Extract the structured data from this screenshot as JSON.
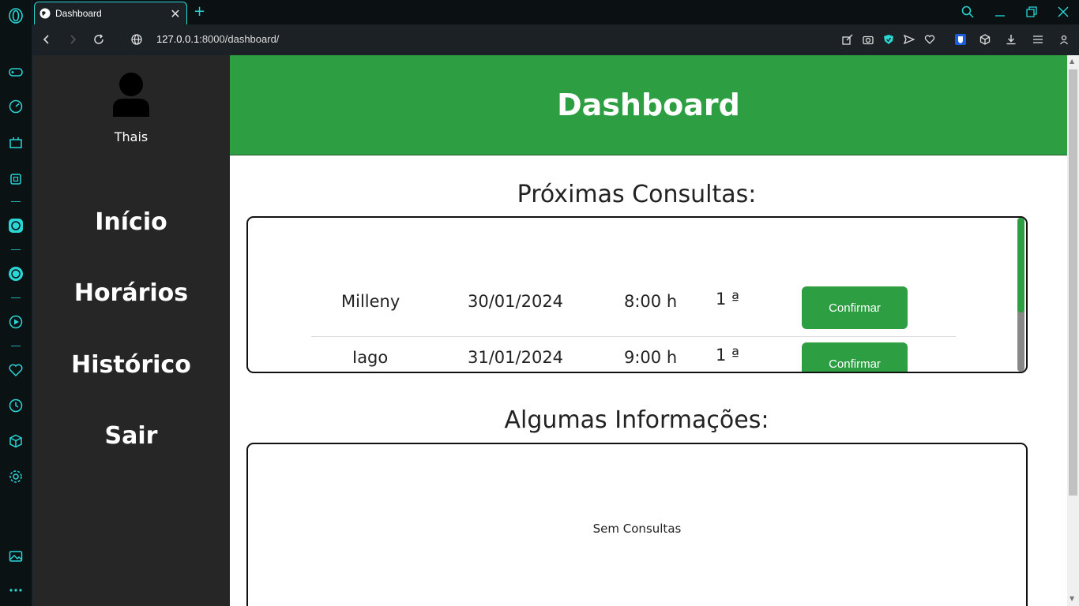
{
  "browser": {
    "tab_title": "Dashboard",
    "url_host": "127.0.0.1",
    "url_path": ":8000/dashboard/",
    "new_tab": "+",
    "close_tab": "✕"
  },
  "sidebar": {
    "username": "Thais",
    "items": [
      {
        "label": "Início"
      },
      {
        "label": "Horários"
      },
      {
        "label": "Histórico"
      },
      {
        "label": "Sair"
      }
    ]
  },
  "header": {
    "title": "Dashboard"
  },
  "upcoming": {
    "title": "Próximas Consultas:",
    "rows": [
      {
        "name": "Milleny",
        "date": "30/01/2024",
        "time": "8:00 h",
        "order": "1 ª",
        "action": "Confirmar"
      },
      {
        "name": "Iago",
        "date": "31/01/2024",
        "time": "9:00 h",
        "order": "1 ª",
        "action": "Confirmar"
      }
    ]
  },
  "info": {
    "title": "Algumas Informações:",
    "empty": "Sem Consultas"
  },
  "colors": {
    "accent": "#2e9e42",
    "sidebar": "#262626",
    "browser_accent": "#2ad6d6"
  }
}
